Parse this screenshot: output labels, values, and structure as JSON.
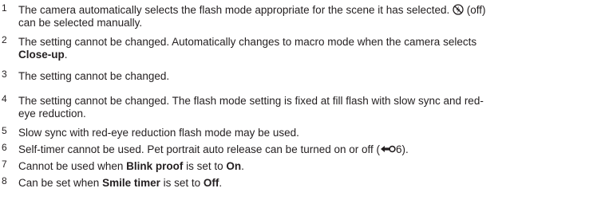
{
  "footnotes": [
    {
      "marker": "1",
      "line1": [
        {
          "t": "The camera automatically selects the flash mode appropriate for the scene it has selected. "
        },
        {
          "icon": "flash-off-icon"
        },
        {
          "t": " (off)"
        }
      ],
      "line2": [
        {
          "t": "can be selected manually."
        }
      ]
    },
    {
      "marker": "2",
      "line1": [
        {
          "t": "The setting cannot be changed. Automatically changes to macro mode when the camera selects"
        }
      ],
      "line2": [
        {
          "t": "Close-up",
          "bold": true
        },
        {
          "t": "."
        }
      ]
    },
    {
      "marker": "3",
      "line1": [
        {
          "t": "The setting cannot be changed."
        }
      ]
    },
    {
      "marker": "4",
      "line1": [
        {
          "t": "The setting cannot be changed. The flash mode setting is fixed at fill flash with slow sync and red-"
        }
      ],
      "line2": [
        {
          "t": "eye reduction."
        }
      ]
    },
    {
      "marker": "5",
      "line1": [
        {
          "t": "Slow sync with red-eye reduction flash mode may be used."
        }
      ]
    },
    {
      "marker": "6",
      "line1": [
        {
          "t": "Self-timer cannot be used. Pet portrait auto release can be turned on or off ("
        },
        {
          "icon": "reference-link-icon"
        },
        {
          "t": "6)."
        }
      ]
    },
    {
      "marker": "7",
      "line1": [
        {
          "t": "Cannot be used when "
        },
        {
          "t": "Blink proof",
          "bold": true
        },
        {
          "t": " is set to "
        },
        {
          "t": "On",
          "bold": true
        },
        {
          "t": "."
        }
      ]
    },
    {
      "marker": "8",
      "line1": [
        {
          "t": "Can be set when "
        },
        {
          "t": "Smile timer",
          "bold": true
        },
        {
          "t": " is set to "
        },
        {
          "t": "Off",
          "bold": true
        },
        {
          "t": "."
        }
      ]
    }
  ]
}
